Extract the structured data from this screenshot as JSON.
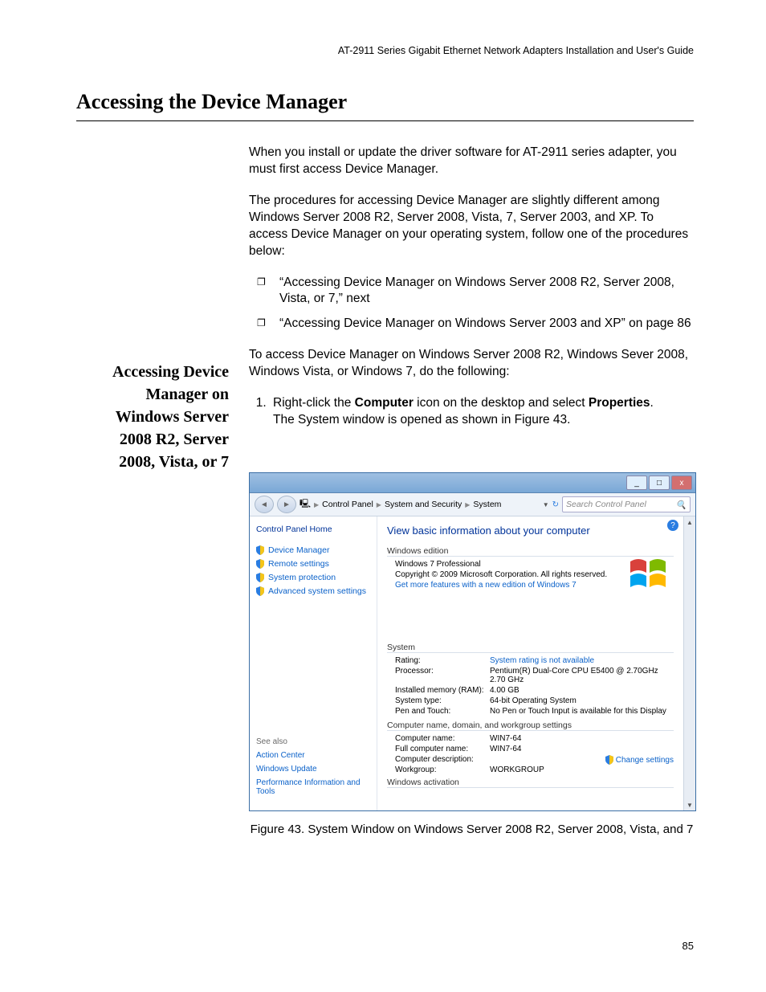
{
  "header": {
    "book_title": "AT-2911 Series Gigabit Ethernet Network Adapters Installation and User's Guide"
  },
  "title": "Accessing the Device Manager",
  "paragraphs": {
    "intro1": "When you install or update the driver software for AT-2911 series adapter, you must first access Device Manager.",
    "intro2": "The procedures for accessing Device Manager are slightly different among Windows Server 2008 R2, Server 2008, Vista, 7, Server 2003, and XP. To access Device Manager on your operating system, follow one of the procedures below:"
  },
  "bullets": {
    "b1": "“Accessing Device Manager on Windows Server 2008 R2, Server 2008, Vista, or 7,”  next",
    "b2": "“Accessing Device Manager on Windows Server 2003 and XP” on page 86"
  },
  "side_heading": "Accessing Device Manager on Windows Server 2008 R2, Server 2008, Vista, or 7",
  "section2": {
    "intro": "To access Device Manager on Windows Server 2008 R2, Windows Sever 2008, Windows Vista, or Windows 7, do the following:",
    "step1_pre": "Right-click the ",
    "step1_bold1": "Computer",
    "step1_mid": " icon on the desktop and select ",
    "step1_bold2": "Properties",
    "step1_post": ".",
    "step1_result": "The System window is opened as shown in Figure 43."
  },
  "win": {
    "breadcrumb": {
      "a": "Control Panel",
      "b": "System and Security",
      "c": "System"
    },
    "search_placeholder": "Search Control Panel",
    "sidebar": {
      "home": "Control Panel Home",
      "links": {
        "devmgr": "Device Manager",
        "remote": "Remote settings",
        "sysprot": "System protection",
        "adv": "Advanced system settings"
      },
      "seealso_label": "See also",
      "seealso": {
        "ac": "Action Center",
        "wu": "Windows Update",
        "perf": "Performance Information and Tools"
      }
    },
    "main": {
      "heading": "View basic information about your computer",
      "edition_label": "Windows edition",
      "edition_name": "Windows 7 Professional",
      "copyright": "Copyright © 2009 Microsoft Corporation.  All rights reserved.",
      "get_more": "Get more features with a new edition of Windows 7",
      "system_label": "System",
      "rating_k": "Rating:",
      "rating_v": "System rating is not available",
      "proc_k": "Processor:",
      "proc_v": "Pentium(R) Dual-Core  CPU      E5400  @ 2.70GHz  2.70 GHz",
      "ram_k": "Installed memory (RAM):",
      "ram_v": "4.00 GB",
      "systype_k": "System type:",
      "systype_v": "64-bit Operating System",
      "pen_k": "Pen and Touch:",
      "pen_v": "No Pen or Touch Input is available for this Display",
      "cndw_label": "Computer name, domain, and workgroup settings",
      "cname_k": "Computer name:",
      "cname_v": "WIN7-64",
      "fcname_k": "Full computer name:",
      "fcname_v": "WIN7-64",
      "cdesc_k": "Computer description:",
      "wg_k": "Workgroup:",
      "wg_v": "WORKGROUP",
      "change_settings": "Change settings",
      "activation_label": "Windows activation"
    }
  },
  "figure_caption": "Figure 43. System Window on Windows Server 2008 R2, Server 2008, Vista, and 7",
  "page_number": "85"
}
